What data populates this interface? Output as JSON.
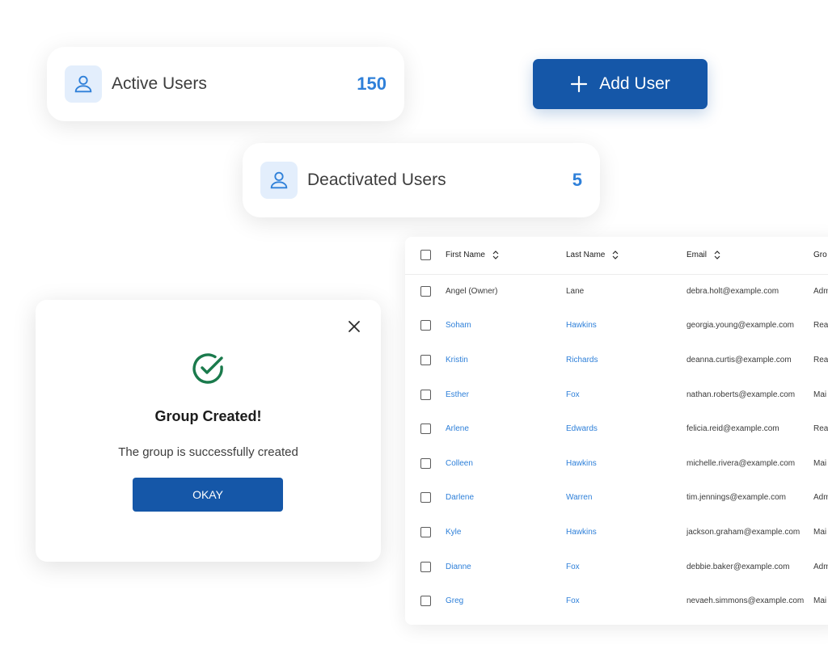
{
  "stats": {
    "active": {
      "label": "Active Users",
      "count": "150",
      "icon": "user-icon"
    },
    "deactivated": {
      "label": "Deactivated Users",
      "count": "5",
      "icon": "user-icon"
    }
  },
  "add_button": {
    "label": "Add User",
    "icon": "plus-icon"
  },
  "modal": {
    "title": "Group Created!",
    "message": "The group is successfully created",
    "ok_label": "OKAY",
    "icon": "check-circle-icon",
    "close_icon": "close-icon"
  },
  "table": {
    "headers": {
      "first": "First Name",
      "last": "Last Name",
      "email": "Email",
      "group": "Gro"
    },
    "rows": [
      {
        "first": "Angel  (Owner)",
        "last": "Lane",
        "email": "debra.holt@example.com",
        "group": "Adm"
      },
      {
        "first": "Soham",
        "last": "Hawkins",
        "email": "georgia.young@example.com",
        "group": "Rea"
      },
      {
        "first": "Kristin",
        "last": "Richards",
        "email": "deanna.curtis@example.com",
        "group": "Rea"
      },
      {
        "first": "Esther",
        "last": "Fox",
        "email": "nathan.roberts@example.com",
        "group": "Mai"
      },
      {
        "first": "Arlene",
        "last": "Edwards",
        "email": "felicia.reid@example.com",
        "group": "Rea"
      },
      {
        "first": "Colleen",
        "last": "Hawkins",
        "email": "michelle.rivera@example.com",
        "group": "Mai"
      },
      {
        "first": "Darlene",
        "last": "Warren",
        "email": "tim.jennings@example.com",
        "group": "Adm"
      },
      {
        "first": "Kyle",
        "last": "Hawkins",
        "email": "jackson.graham@example.com",
        "group": "Mai"
      },
      {
        "first": "Dianne",
        "last": "Fox",
        "email": "debbie.baker@example.com",
        "group": "Adm"
      },
      {
        "first": "Greg",
        "last": "Fox",
        "email": "nevaeh.simmons@example.com",
        "group": "Mai"
      }
    ]
  },
  "colors": {
    "primary": "#1557a8",
    "accent": "#2f80d9",
    "success": "#1a7a4c",
    "icon_bg": "#e3eefc"
  }
}
